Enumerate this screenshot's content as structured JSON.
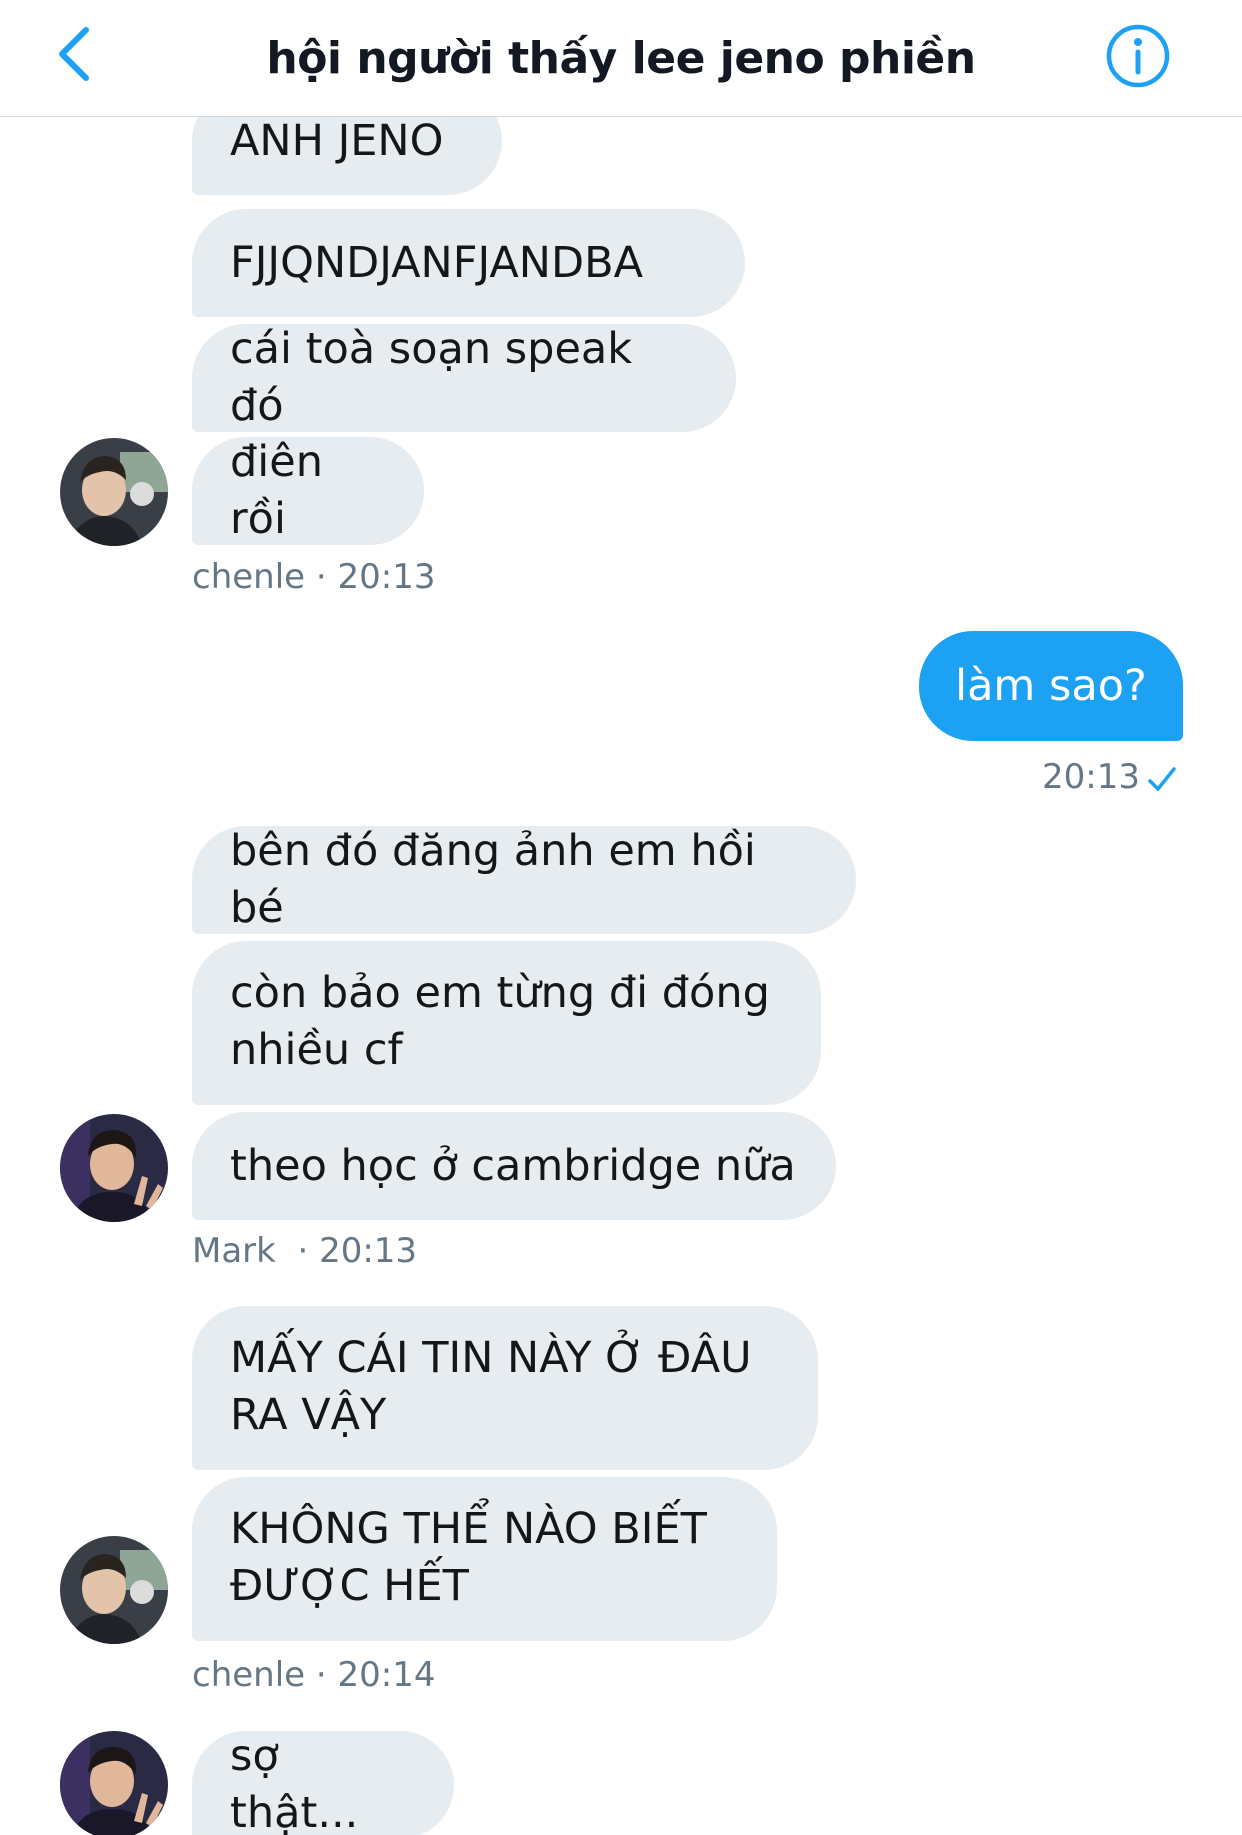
{
  "header": {
    "title": "hội người thấy lee jeno phiền"
  },
  "colors": {
    "accent": "#1da1f2",
    "incoming_bubble": "#e6ecf0",
    "meta_text": "#657786"
  },
  "messages": {
    "g1": {
      "m1": "ANH JENO",
      "m2": "FJJQNDJANFJANDBA",
      "m3": "cái toà soạn speak đó",
      "m4": "điên rồi",
      "sender": "chenle",
      "time": "· 20:13"
    },
    "out1": {
      "text": "làm sao?",
      "time": "20:13"
    },
    "g2": {
      "m1": "bên đó đăng ảnh em hồi bé",
      "m2": "còn bảo em từng đi đóng nhiều cf",
      "m3": "theo học ở cambridge nữa",
      "sender": "Mark",
      "time": " · 20:13"
    },
    "g3": {
      "m1": "MẤY CÁI TIN NÀY Ở ĐÂU RA VẬY",
      "m2": "KHÔNG THỂ NÀO BIẾT ĐƯỢC HẾT",
      "sender": "chenle",
      "time": "· 20:14"
    },
    "g4": {
      "m1": "sợ thật..."
    }
  },
  "icons": {
    "back": "chevron-left-icon",
    "info": "info-circle-icon",
    "read": "checkmark-icon"
  }
}
